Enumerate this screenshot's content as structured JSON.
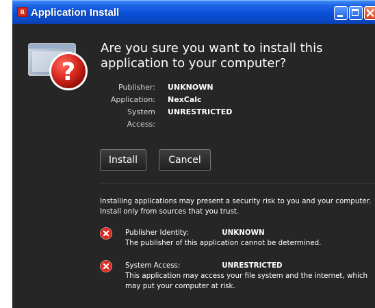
{
  "window": {
    "title": "Application Install",
    "logo_letter": "a"
  },
  "dialog": {
    "heading": "Are you sure you want to install this application to your computer?",
    "details": [
      {
        "label": "Publisher:",
        "value": "UNKNOWN"
      },
      {
        "label": "Application:",
        "value": "NexCalc"
      },
      {
        "label": "System Access:",
        "value": "UNRESTRICTED"
      }
    ],
    "install_label": "Install",
    "cancel_label": "Cancel",
    "warning": "Installing applications may present a security risk to you and your computer. Install only from sources that you trust.",
    "risks": [
      {
        "label": "Publisher Identity:",
        "value": "UNKNOWN",
        "description": "The publisher of this application cannot be determined."
      },
      {
        "label": "System Access:",
        "value": "UNRESTRICTED",
        "description": "This application may access your file system and the internet, which may put your computer at risk."
      }
    ]
  },
  "icons": {
    "header": "install-question-icon",
    "risk": "error-x-icon"
  },
  "colors": {
    "background": "#262626",
    "titlebar": "#0a4fd6",
    "danger": "#d9281f",
    "text": "#ffffff"
  }
}
